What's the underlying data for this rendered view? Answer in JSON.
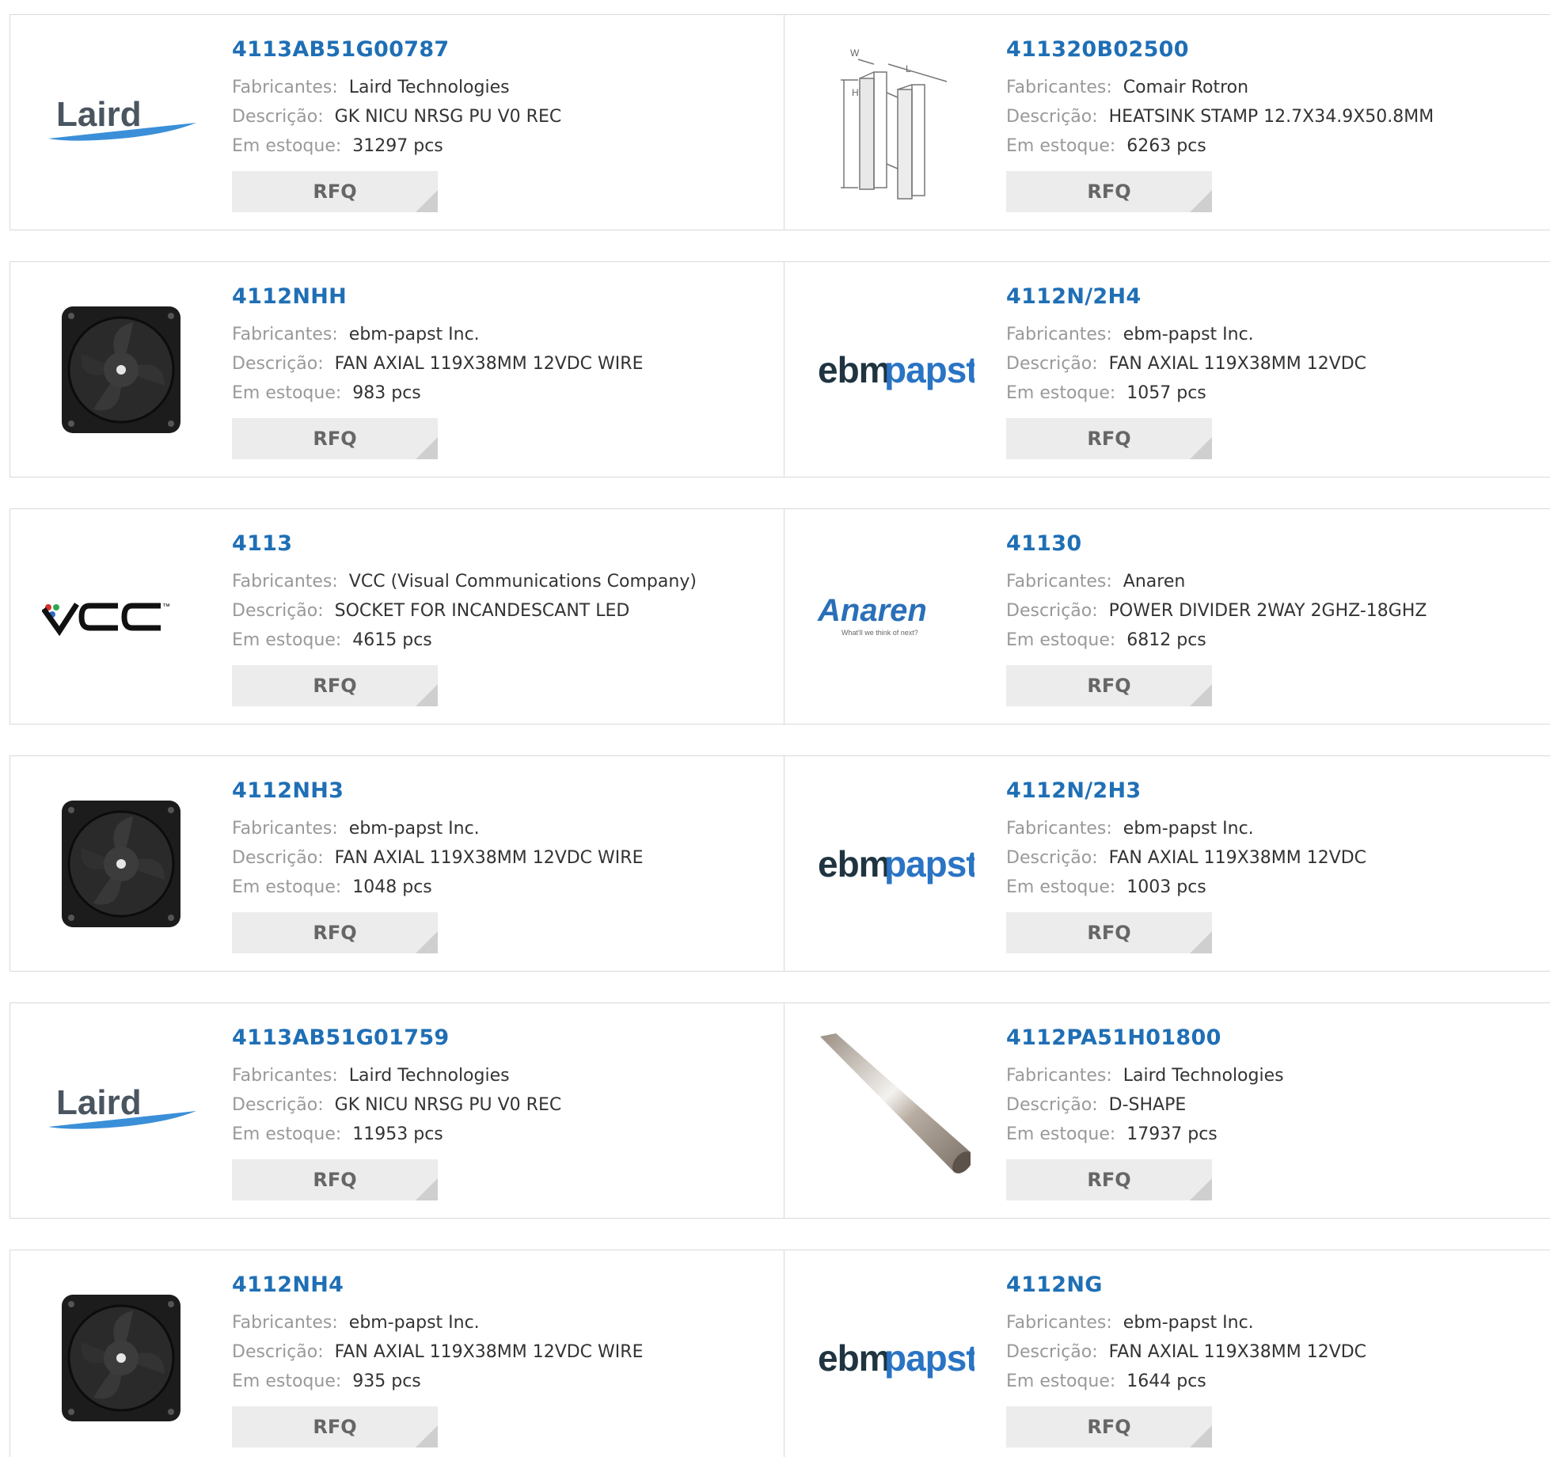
{
  "labels": {
    "manufacturer": "Fabricantes:",
    "description": "Descrição:",
    "stock": "Em estoque:",
    "rfq": "RFQ"
  },
  "logos": {
    "laird": "Laird",
    "ebm": "ebm",
    "papst": "papst",
    "vcc": "VCC",
    "tm": "™",
    "anaren": "Anaren",
    "anaren_tag": "What'll we think of next?",
    "heatsink_w": "W",
    "heatsink_l": "L",
    "heatsink_h": "H"
  },
  "products": [
    {
      "pn": "4113AB51G00787",
      "manufacturer": "Laird Technologies",
      "description": "GK NICU NRSG PU V0 REC",
      "stock": "31297 pcs",
      "image": "laird-logo"
    },
    {
      "pn": "411320B02500",
      "manufacturer": "Comair Rotron",
      "description": "HEATSINK STAMP 12.7X34.9X50.8MM",
      "stock": "6263 pcs",
      "image": "heatsink-drawing"
    },
    {
      "pn": "4112NHH",
      "manufacturer": "ebm-papst Inc.",
      "description": "FAN AXIAL 119X38MM 12VDC WIRE",
      "stock": "983 pcs",
      "image": "fan-photo"
    },
    {
      "pn": "4112N/2H4",
      "manufacturer": "ebm-papst Inc.",
      "description": "FAN AXIAL 119X38MM 12VDC",
      "stock": "1057 pcs",
      "image": "ebmpapst-logo"
    },
    {
      "pn": "4113",
      "manufacturer": "VCC (Visual Communications Company)",
      "description": "SOCKET FOR INCANDESCANT LED",
      "stock": "4615 pcs",
      "image": "vcc-logo"
    },
    {
      "pn": "41130",
      "manufacturer": "Anaren",
      "description": "POWER DIVIDER 2WAY 2GHZ-18GHZ",
      "stock": "6812 pcs",
      "image": "anaren-logo"
    },
    {
      "pn": "4112NH3",
      "manufacturer": "ebm-papst Inc.",
      "description": "FAN AXIAL 119X38MM 12VDC WIRE",
      "stock": "1048 pcs",
      "image": "fan-photo"
    },
    {
      "pn": "4112N/2H3",
      "manufacturer": "ebm-papst Inc.",
      "description": "FAN AXIAL 119X38MM 12VDC",
      "stock": "1003 pcs",
      "image": "ebmpapst-logo"
    },
    {
      "pn": "4113AB51G01759",
      "manufacturer": "Laird Technologies",
      "description": "GK NICU NRSG PU V0 REC",
      "stock": "11953 pcs",
      "image": "laird-logo"
    },
    {
      "pn": "4112PA51H01800",
      "manufacturer": "Laird Technologies",
      "description": "D-SHAPE",
      "stock": "17937 pcs",
      "image": "gasket-photo"
    },
    {
      "pn": "4112NH4",
      "manufacturer": "ebm-papst Inc.",
      "description": "FAN AXIAL 119X38MM 12VDC WIRE",
      "stock": "935 pcs",
      "image": "fan-photo"
    },
    {
      "pn": "4112NG",
      "manufacturer": "ebm-papst Inc.",
      "description": "FAN AXIAL 119X38MM 12VDC",
      "stock": "1644 pcs",
      "image": "ebmpapst-logo"
    }
  ],
  "colors": {
    "part_number": "#1f6fb5",
    "label": "#999999",
    "value": "#333333",
    "rfq_bg": "#ececec",
    "rfq_text": "#666666",
    "ebm_dark": "#1f3440",
    "papst_blue": "#2a74c4",
    "laird_swoosh": "#3a8fd8",
    "anaren_blue": "#2a6fb8"
  }
}
